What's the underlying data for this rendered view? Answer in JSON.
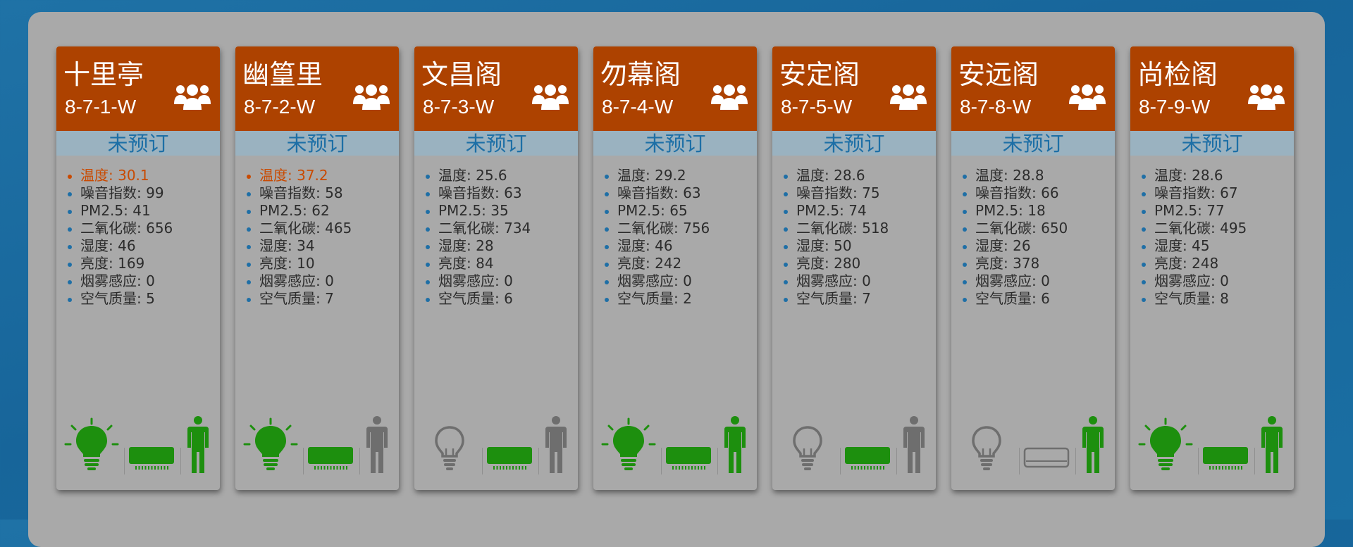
{
  "status_colors": {
    "header": "#ad4200",
    "active": "#1d8f0e",
    "inactive": "#6e6e6e",
    "alert": "#c94a00"
  },
  "rooms": [
    {
      "name": "十里亭",
      "code": "8-7-1-W",
      "status": "未预订",
      "metrics": [
        "温度: 30.1",
        "噪音指数: 99",
        "PM2.5: 41",
        "二氧化碳: 656",
        "湿度: 46",
        "亮度: 169",
        "烟雾感应: 0",
        "空气质量: 5"
      ],
      "alert_metric": 0,
      "devices": {
        "light_on": true,
        "ac_on": true,
        "occupied": true
      }
    },
    {
      "name": "幽篁里",
      "code": "8-7-2-W",
      "status": "未预订",
      "metrics": [
        "温度: 37.2",
        "噪音指数: 58",
        "PM2.5: 62",
        "二氧化碳: 465",
        "湿度: 34",
        "亮度: 10",
        "烟雾感应: 0",
        "空气质量: 7"
      ],
      "alert_metric": 0,
      "devices": {
        "light_on": true,
        "ac_on": true,
        "occupied": false
      }
    },
    {
      "name": "文昌阁",
      "code": "8-7-3-W",
      "status": "未预订",
      "metrics": [
        "温度: 25.6",
        "噪音指数: 63",
        "PM2.5: 35",
        "二氧化碳: 734",
        "湿度: 28",
        "亮度: 84",
        "烟雾感应: 0",
        "空气质量: 6"
      ],
      "alert_metric": -1,
      "devices": {
        "light_on": false,
        "ac_on": true,
        "occupied": false
      }
    },
    {
      "name": "勿幕阁",
      "code": "8-7-4-W",
      "status": "未预订",
      "metrics": [
        "温度: 29.2",
        "噪音指数: 63",
        "PM2.5: 65",
        "二氧化碳: 756",
        "湿度: 46",
        "亮度: 242",
        "烟雾感应: 0",
        "空气质量: 2"
      ],
      "alert_metric": -1,
      "devices": {
        "light_on": true,
        "ac_on": true,
        "occupied": true
      }
    },
    {
      "name": "安定阁",
      "code": "8-7-5-W",
      "status": "未预订",
      "metrics": [
        "温度: 28.6",
        "噪音指数: 75",
        "PM2.5: 74",
        "二氧化碳: 518",
        "湿度: 50",
        "亮度: 280",
        "烟雾感应: 0",
        "空气质量: 7"
      ],
      "alert_metric": -1,
      "devices": {
        "light_on": false,
        "ac_on": true,
        "occupied": false
      }
    },
    {
      "name": "安远阁",
      "code": "8-7-8-W",
      "status": "未预订",
      "metrics": [
        "温度: 28.8",
        "噪音指数: 66",
        "PM2.5: 18",
        "二氧化碳: 650",
        "湿度: 26",
        "亮度: 378",
        "烟雾感应: 0",
        "空气质量: 6"
      ],
      "alert_metric": -1,
      "devices": {
        "light_on": false,
        "ac_on": false,
        "occupied": true
      }
    },
    {
      "name": "尚检阁",
      "code": "8-7-9-W",
      "status": "未预订",
      "metrics": [
        "温度: 28.6",
        "噪音指数: 67",
        "PM2.5: 77",
        "二氧化碳: 495",
        "湿度: 45",
        "亮度: 248",
        "烟雾感应: 0",
        "空气质量: 8"
      ],
      "alert_metric": -1,
      "devices": {
        "light_on": true,
        "ac_on": true,
        "occupied": true
      }
    }
  ]
}
